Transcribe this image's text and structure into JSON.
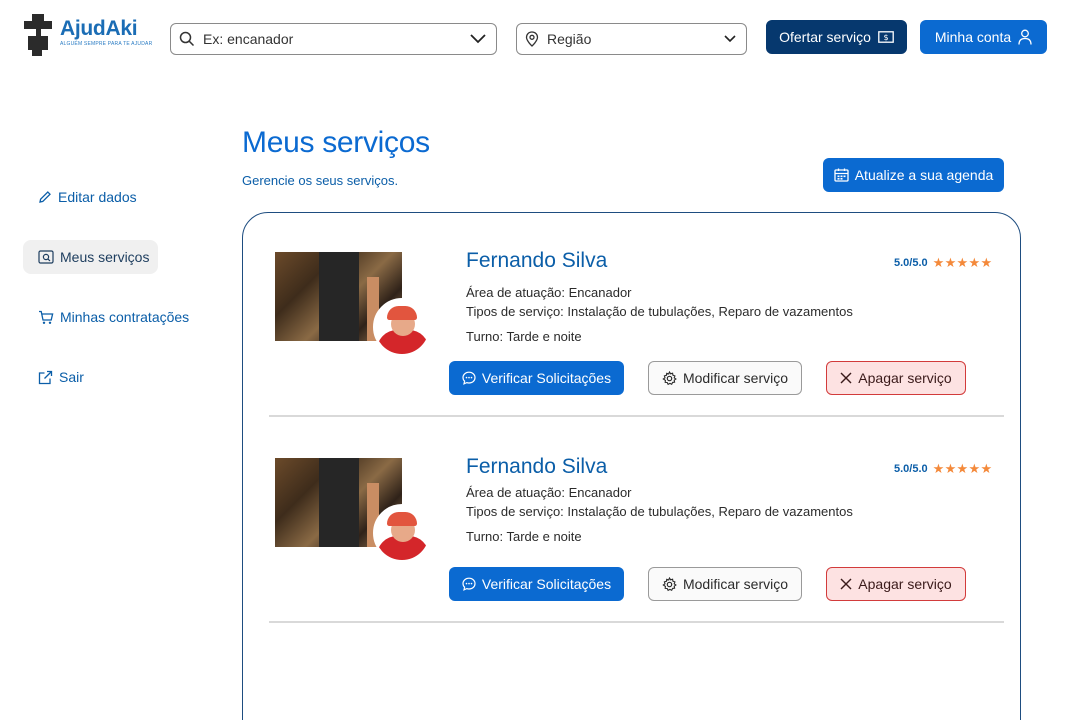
{
  "brand": {
    "name": "AjudAki",
    "tagline": "ALGUÉM SEMPRE PARA TE AJUDAR",
    "color": "#1b6db5"
  },
  "header": {
    "search_placeholder": "Ex: encanador",
    "region_placeholder": "Região",
    "offer_button": "Ofertar serviço",
    "account_button": "Minha conta"
  },
  "sidebar": {
    "items": [
      {
        "label": "Editar dados",
        "icon": "pencil-icon",
        "active": false
      },
      {
        "label": "Meus serviços",
        "icon": "search-doc-icon",
        "active": true
      },
      {
        "label": "Minhas contratações",
        "icon": "cart-icon",
        "active": false
      },
      {
        "label": "Sair",
        "icon": "external-link-icon",
        "active": false
      }
    ]
  },
  "main": {
    "title": "Meus serviços",
    "subtitle": "Gerencie os seus serviços.",
    "agenda_button": "Atualize a sua agenda",
    "services": [
      {
        "name": "Fernando Silva",
        "rating": "5.0/5.0",
        "stars": "★★★★★",
        "area": "Área de atuação: Encanador",
        "types": "Tipos de serviço: Instalação de tubulações, Reparo de vazamentos",
        "shift": "Turno: Tarde e noite",
        "verify_button": "Verificar Solicitações",
        "modify_button": "Modificar serviço",
        "delete_button": "Apagar serviço"
      },
      {
        "name": "Fernando Silva",
        "rating": "5.0/5.0",
        "stars": "★★★★★",
        "area": "Área de atuação: Encanador",
        "types": "Tipos de serviço: Instalação de tubulações, Reparo de vazamentos",
        "shift": "Turno: Tarde e noite",
        "verify_button": "Verificar Solicitações",
        "modify_button": "Modificar serviço",
        "delete_button": "Apagar serviço"
      }
    ]
  },
  "colors": {
    "primary": "#0b6ad1",
    "dark_primary": "#06386e",
    "star": "#f4893a",
    "danger_bg": "#fde2e2",
    "danger_border": "#d23b3b"
  }
}
